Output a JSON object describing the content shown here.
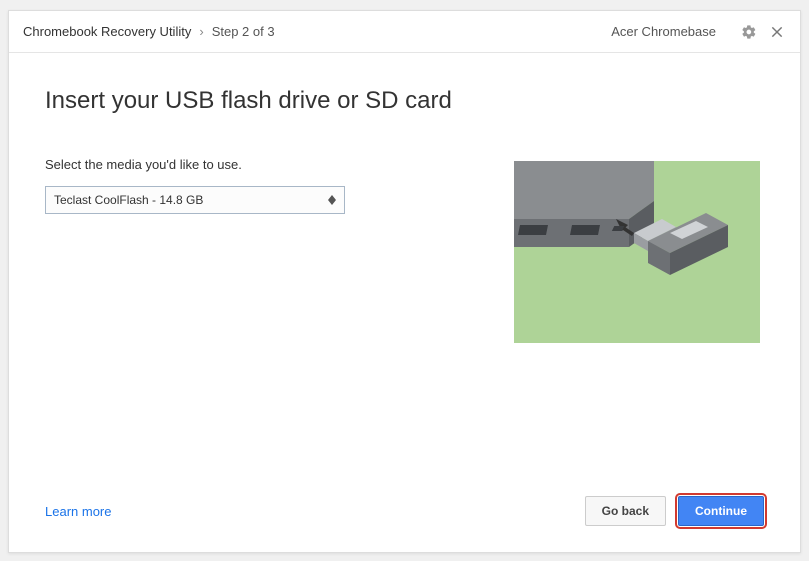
{
  "header": {
    "title": "Chromebook Recovery Utility",
    "chevron": "›",
    "step": "Step 2 of 3",
    "device": "Acer Chromebase"
  },
  "main": {
    "heading": "Insert your USB flash drive or SD card",
    "prompt": "Select the media you'd like to use.",
    "select_value": "Teclast CoolFlash - 14.8 GB"
  },
  "footer": {
    "learn_more": "Learn more",
    "go_back": "Go back",
    "continue": "Continue"
  }
}
